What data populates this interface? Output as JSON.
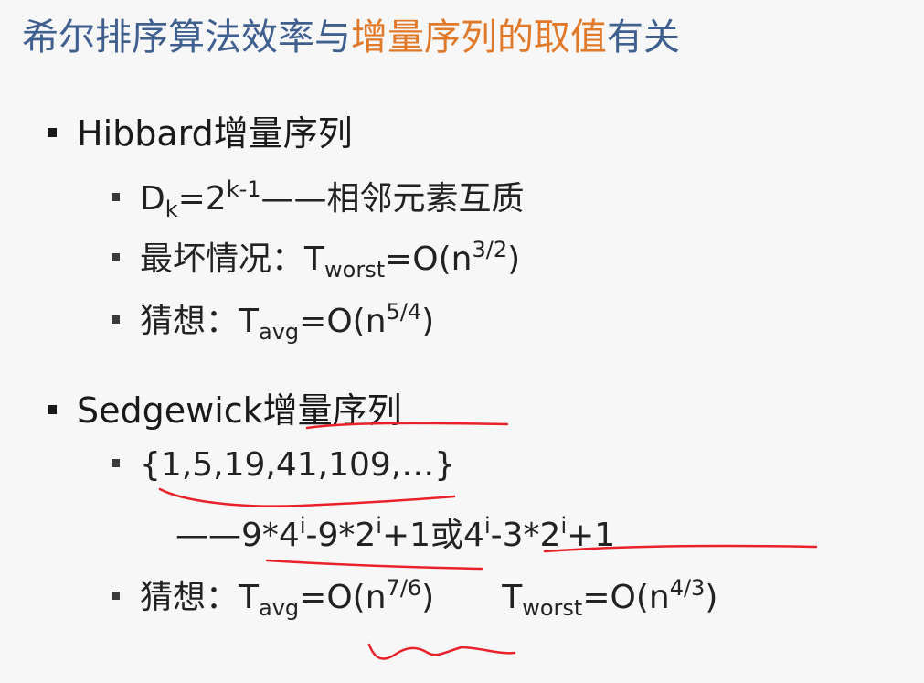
{
  "title": {
    "part1": "希尔排序算法效率与",
    "highlight": "增量序列的取值",
    "part2": "有关",
    "highlight_color": "#e0792a",
    "base_color": "#3f5f8f"
  },
  "hibbard": {
    "heading": "Hibbard增量序列",
    "formula": {
      "d": "D",
      "d_sub": "k",
      "eq": "=2",
      "exp": "k-1",
      "tail": "——相邻元素互质"
    },
    "worst": {
      "label": "最坏情况：",
      "t": "T",
      "t_sub": "worst",
      "eq": "=O(n",
      "exp": "3/2",
      "close": ")"
    },
    "avg": {
      "label": "猜想：",
      "t": "T",
      "t_sub": "avg",
      "eq": "=O(n",
      "exp": "5/4",
      "close": ")"
    }
  },
  "sedgewick": {
    "heading": "Sedgewick增量序列",
    "sequence": "{1,5,19,41,109,…}",
    "formula": {
      "dash": "——",
      "a": "9*4",
      "a_exp": "i",
      "b": "-9*2",
      "b_exp": "i",
      "c": "+1或",
      "d": "4",
      "d_exp": "i",
      "e": "-3*2",
      "e_exp": "i",
      "f": "+1"
    },
    "guess": {
      "label": "猜想：",
      "avg_t": "T",
      "avg_sub": "avg",
      "avg_eq": "=O(n",
      "avg_exp": "7/6",
      "avg_close": ")",
      "worst_t": "T",
      "worst_sub": "worst",
      "worst_eq": "=O(n",
      "worst_exp": "4/3",
      "worst_close": ")"
    }
  },
  "annotation_color": "#e8222a"
}
